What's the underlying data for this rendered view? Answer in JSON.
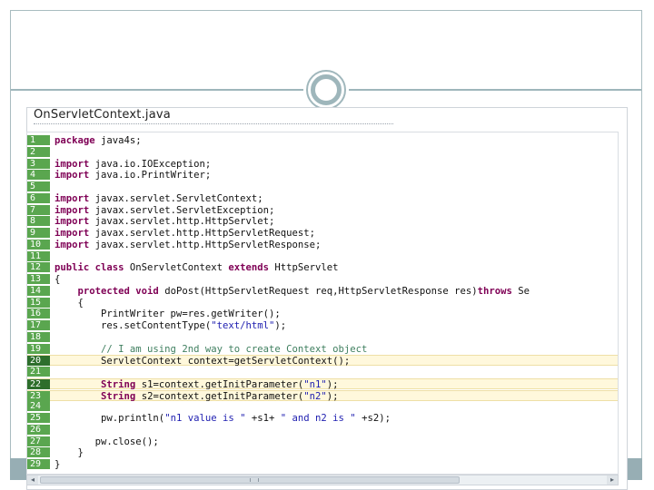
{
  "window": {
    "title": "OnServletContext.java"
  },
  "editor": {
    "lines": [
      {
        "n": "1",
        "parts": [
          {
            "t": "package ",
            "c": "kw"
          },
          {
            "t": "java4s;"
          }
        ]
      },
      {
        "n": "2",
        "parts": []
      },
      {
        "n": "3",
        "parts": [
          {
            "t": "import ",
            "c": "kw"
          },
          {
            "t": "java.io.IOException;"
          }
        ]
      },
      {
        "n": "4",
        "parts": [
          {
            "t": "import ",
            "c": "kw"
          },
          {
            "t": "java.io.PrintWriter;"
          }
        ]
      },
      {
        "n": "5",
        "parts": []
      },
      {
        "n": "6",
        "parts": [
          {
            "t": "import ",
            "c": "kw"
          },
          {
            "t": "javax.servlet.ServletContext;"
          }
        ]
      },
      {
        "n": "7",
        "parts": [
          {
            "t": "import ",
            "c": "kw"
          },
          {
            "t": "javax.servlet.ServletException;"
          }
        ]
      },
      {
        "n": "8",
        "parts": [
          {
            "t": "import ",
            "c": "kw"
          },
          {
            "t": "javax.servlet.http.HttpServlet;"
          }
        ]
      },
      {
        "n": "9",
        "parts": [
          {
            "t": "import ",
            "c": "kw"
          },
          {
            "t": "javax.servlet.http.HttpServletRequest;"
          }
        ]
      },
      {
        "n": "10",
        "parts": [
          {
            "t": "import ",
            "c": "kw"
          },
          {
            "t": "javax.servlet.http.HttpServletResponse;"
          }
        ]
      },
      {
        "n": "11",
        "parts": []
      },
      {
        "n": "12",
        "parts": [
          {
            "t": "public class ",
            "c": "kw"
          },
          {
            "t": "OnServletContext "
          },
          {
            "t": "extends ",
            "c": "kw"
          },
          {
            "t": "HttpServlet"
          }
        ]
      },
      {
        "n": "13",
        "parts": [
          {
            "t": "{"
          }
        ]
      },
      {
        "n": "14",
        "parts": [
          {
            "t": "    "
          },
          {
            "t": "protected void ",
            "c": "kw"
          },
          {
            "t": "doPost(HttpServletRequest req,HttpServletResponse res)"
          },
          {
            "t": "throws ",
            "c": "kw"
          },
          {
            "t": "Se"
          }
        ]
      },
      {
        "n": "15",
        "parts": [
          {
            "t": "    {"
          }
        ]
      },
      {
        "n": "16",
        "parts": [
          {
            "t": "        PrintWriter pw=res.getWriter();"
          }
        ]
      },
      {
        "n": "17",
        "parts": [
          {
            "t": "        res.setContentType("
          },
          {
            "t": "\"text/html\"",
            "c": "str"
          },
          {
            "t": ");"
          }
        ]
      },
      {
        "n": "18",
        "parts": []
      },
      {
        "n": "19",
        "parts": [
          {
            "t": "        // I am using 2nd way to create Context object",
            "c": "cm"
          }
        ]
      },
      {
        "n": "20",
        "hl": true,
        "dark": true,
        "parts": [
          {
            "t": "        ServletContext context=getServletContext();"
          }
        ]
      },
      {
        "n": "21",
        "parts": []
      },
      {
        "n": "22",
        "hl": true,
        "dark": true,
        "parts": [
          {
            "t": "        "
          },
          {
            "t": "String ",
            "c": "kw"
          },
          {
            "t": "s1=context.getInitParameter("
          },
          {
            "t": "\"n1\"",
            "c": "str"
          },
          {
            "t": ");"
          }
        ]
      },
      {
        "n": "23",
        "hl": true,
        "parts": [
          {
            "t": "        "
          },
          {
            "t": "String ",
            "c": "kw"
          },
          {
            "t": "s2=context.getInitParameter("
          },
          {
            "t": "\"n2\"",
            "c": "str"
          },
          {
            "t": ");"
          }
        ]
      },
      {
        "n": "24",
        "parts": []
      },
      {
        "n": "25",
        "parts": [
          {
            "t": "        pw.println("
          },
          {
            "t": "\"n1 value is \"",
            "c": "str"
          },
          {
            "t": " +s1+ "
          },
          {
            "t": "\" and n2 is \"",
            "c": "str"
          },
          {
            "t": " +s2);"
          }
        ]
      },
      {
        "n": "26",
        "parts": []
      },
      {
        "n": "27",
        "parts": [
          {
            "t": "       pw.close();"
          }
        ]
      },
      {
        "n": "28",
        "parts": [
          {
            "t": "    }"
          }
        ]
      },
      {
        "n": "29",
        "parts": [
          {
            "t": "}"
          }
        ]
      }
    ]
  },
  "scrollbar": {
    "left_arrow": "◂",
    "right_arrow": "▸"
  }
}
